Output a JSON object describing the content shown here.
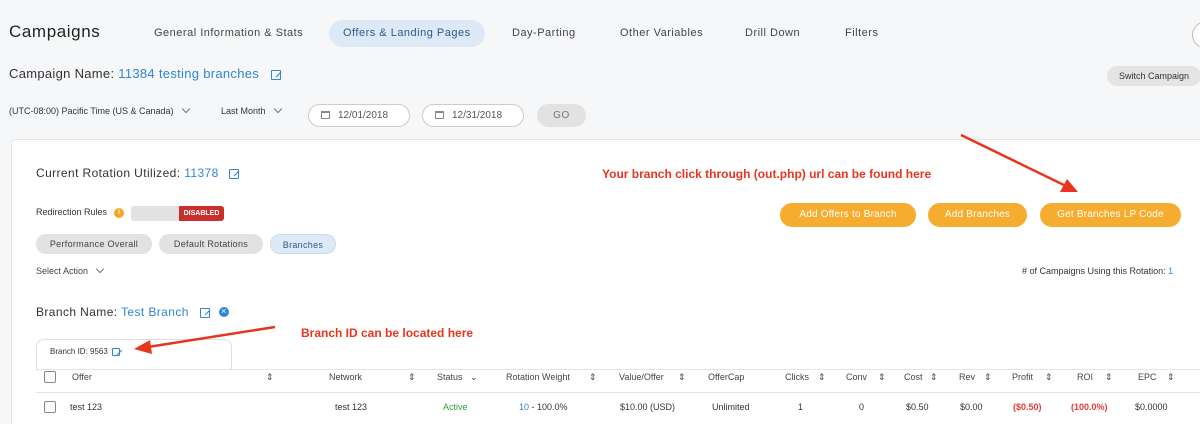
{
  "app": {
    "title": "Campaigns"
  },
  "nav": {
    "tabs": [
      {
        "label": "General Information & Stats"
      },
      {
        "label": "Offers & Landing Pages"
      },
      {
        "label": "Day-Parting"
      },
      {
        "label": "Other Variables"
      },
      {
        "label": "Drill Down"
      },
      {
        "label": "Filters"
      }
    ],
    "active_tab": "Offers & Landing Pages"
  },
  "campaign": {
    "label": "Campaign Name:",
    "name": "11384 testing branches"
  },
  "switch_campaign_label": "Switch Campaign",
  "filters": {
    "timezone": "(UTC-08:00) Pacific Time (US & Canada)",
    "range": "Last Month",
    "start_date": "12/01/2018",
    "end_date": "12/31/2018",
    "go_label": "GO"
  },
  "rotation": {
    "label": "Current Rotation Utilized:",
    "value": "11378"
  },
  "annotations": {
    "branch_url": "Your branch click through (out.php) url can be found here",
    "branch_id": "Branch ID can be located here"
  },
  "redirection": {
    "label": "Redirection Rules",
    "state": "DISABLED"
  },
  "actions": {
    "add_offers": "Add Offers to Branch",
    "add_branches": "Add Branches",
    "get_lp_code": "Get Branches LP Code"
  },
  "view_tabs": [
    {
      "label": "Performance Overall"
    },
    {
      "label": "Default Rotations"
    },
    {
      "label": "Branches"
    }
  ],
  "select_action_label": "Select Action",
  "campaigns_using": {
    "label": "# of Campaigns Using this Rotation:",
    "count": "1"
  },
  "branch": {
    "label": "Branch Name:",
    "name": "Test Branch",
    "id_label": "Branch ID: 9563"
  },
  "table": {
    "headers": [
      "Offer",
      "Network",
      "Status",
      "Rotation Weight",
      "Value/Offer",
      "OfferCap",
      "Clicks",
      "Conv",
      "Cost",
      "Rev",
      "Profit",
      "ROI",
      "EPC"
    ],
    "rows": [
      {
        "offer": "test 123",
        "network": "test 123",
        "status": "Active",
        "weight": "10",
        "weight_pct": "- 100.0%",
        "value": "$10.00 (USD)",
        "cap": "Unlimited",
        "clicks": "1",
        "conv": "0",
        "cost": "$0.50",
        "rev": "$0.00",
        "profit": "($0.50)",
        "roi": "(100.0%)",
        "epc": "$0.0000"
      }
    ]
  },
  "colors": {
    "accent": "#2e86d4",
    "orange": "#f5ac2f",
    "annotation": "#e8351f",
    "disabled": "#c9302c"
  }
}
